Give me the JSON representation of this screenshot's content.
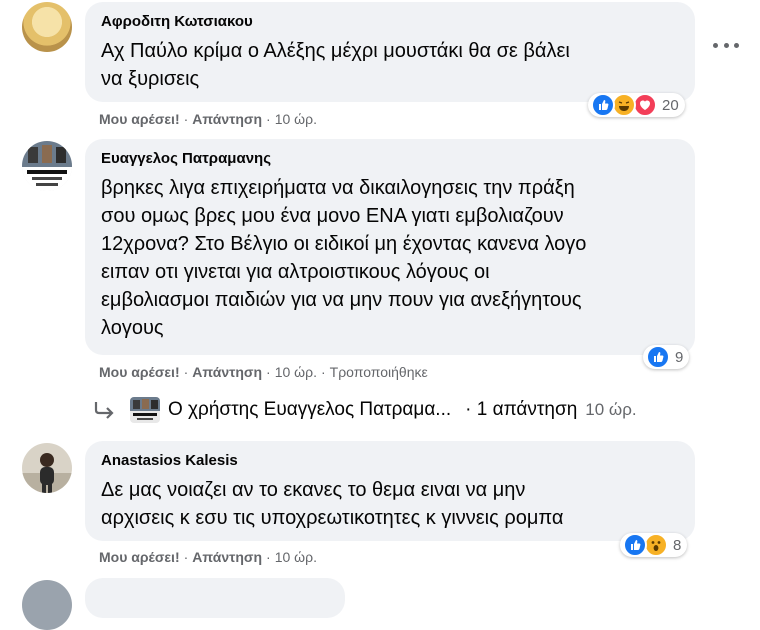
{
  "comments": [
    {
      "author": "Αφροδιτη Κωτσιακου",
      "text": "Αχ Παύλο κρίμα ο Αλέξης μέχρι μουστάκι θα σε βάλει\nνα ξυρισεις",
      "like_label": "Μου αρέσει!",
      "reply_label": "Απάντηση",
      "time": "10 ώρ.",
      "reaction_icons": [
        "like-icon",
        "haha-icon",
        "love-icon"
      ],
      "reaction_count": "20"
    },
    {
      "author": "Ευαγγελος Πατραμανης",
      "text": "βρηκες λιγα επιχειρήματα να δικαιλογησεις την πράξη\nσου ομως βρες μου ένα μονο ΕΝΑ γιατι εμβολιαζουν\n12χρονα? Στο Βέλγιο οι ειδικοί μη έχοντας κανενα λογο\nειπαν οτι γινεται για αλτροιστικους λόγους οι\nεμβολιασμοι παιδιών για να μην πουν για ανεξήγητους\nλογους",
      "like_label": "Μου αρέσει!",
      "reply_label": "Απάντηση",
      "time": "10 ώρ.",
      "edited_label": "Τροποποιήθηκε",
      "reaction_icons": [
        "like-icon"
      ],
      "reaction_count": "9"
    },
    {
      "author": "Anastasios Kalesis",
      "text": "Δε μας νοιαζει αν το εκανες το θεμα ειναι να μην\nαρχισεις κ εσυ τις υποχρεωτικοτητες κ γιννεις ρομπα",
      "like_label": "Μου αρέσει!",
      "reply_label": "Απάντηση",
      "time": "10 ώρ.",
      "reaction_icons": [
        "like-icon",
        "wow-icon"
      ],
      "reaction_count": "8"
    }
  ],
  "reply_thread": {
    "user_text": "Ο χρήστης Ευαγγελος Πατραμα...",
    "count_text": "· 1 απάντηση",
    "time": "10 ώρ."
  },
  "colors": {
    "bubble": "#f0f2f5",
    "meta_text": "#65676b",
    "like_blue": "#1877f2",
    "love_red": "#f33e58",
    "haha_yellow": "#f7b125"
  }
}
